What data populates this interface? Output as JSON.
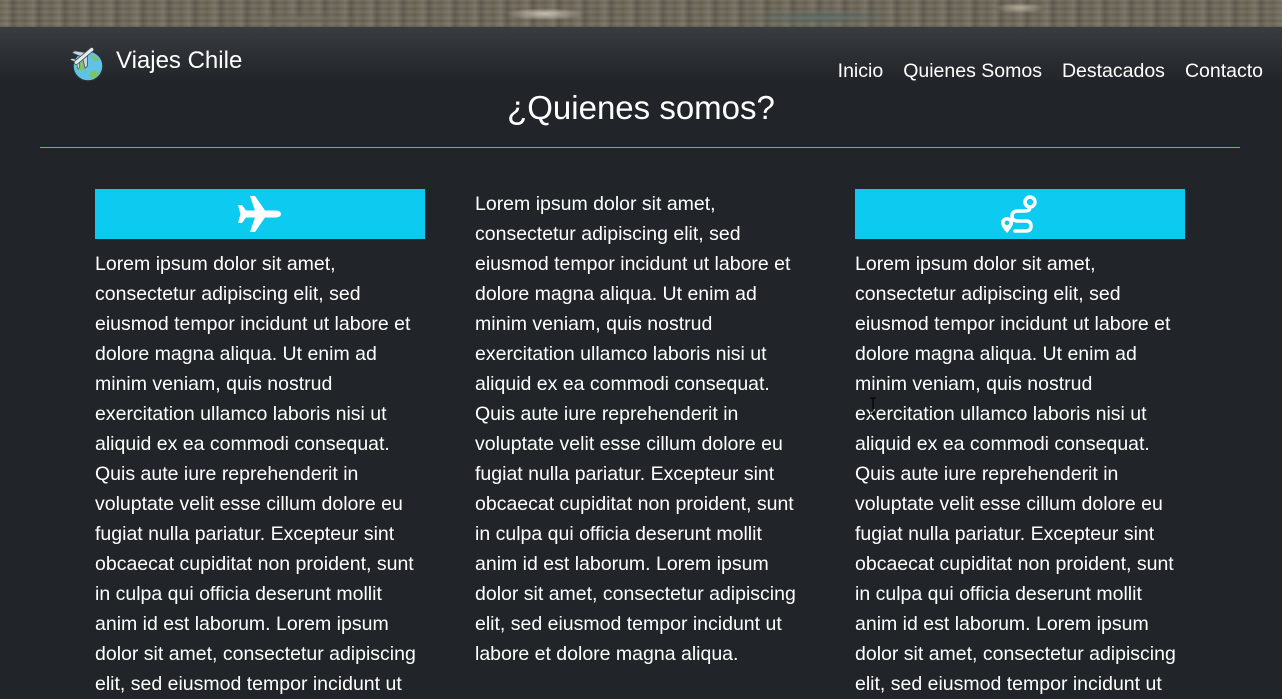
{
  "brand": {
    "name": "Viajes Chile"
  },
  "nav": {
    "items": [
      {
        "label": "Inicio"
      },
      {
        "label": "Quienes Somos"
      },
      {
        "label": "Destacados"
      },
      {
        "label": "Contacto"
      }
    ]
  },
  "section": {
    "title": "¿Quienes somos?"
  },
  "columns": [
    {
      "icon": "airplane-icon",
      "text": "Lorem ipsum dolor sit amet, consectetur adipiscing elit, sed eiusmod tempor incidunt ut labore et dolore magna aliqua. Ut enim ad minim veniam, quis nostrud exercitation ullamco laboris nisi ut aliquid ex ea commodi consequat. Quis aute iure reprehenderit in voluptate velit esse cillum dolore eu fugiat nulla pariatur. Excepteur sint obcaecat cupiditat non proident, sunt in culpa qui officia deserunt mollit anim id est laborum. Lorem ipsum dolor sit amet, consectetur adipiscing elit, sed eiusmod tempor incidunt ut"
    },
    {
      "icon": null,
      "text": "Lorem ipsum dolor sit amet, consectetur adipiscing elit, sed eiusmod tempor incidunt ut labore et dolore magna aliqua. Ut enim ad minim veniam, quis nostrud exercitation ullamco laboris nisi ut aliquid ex ea commodi consequat. Quis aute iure reprehenderit in voluptate velit esse cillum dolore eu fugiat nulla pariatur. Excepteur sint obcaecat cupiditat non proident, sunt in culpa qui officia deserunt mollit anim id est laborum. Lorem ipsum dolor sit amet, consectetur adipiscing elit, sed eiusmod tempor incidunt ut labore et dolore magna aliqua."
    },
    {
      "icon": "route-icon",
      "text": "Lorem ipsum dolor sit amet, consectetur adipiscing elit, sed eiusmod tempor incidunt ut labore et dolore magna aliqua. Ut enim ad minim veniam, quis nostrud exercitation ullamco laboris nisi ut aliquid ex ea commodi consequat. Quis aute iure reprehenderit in voluptate velit esse cillum dolore eu fugiat nulla pariatur. Excepteur sint obcaecat cupiditat non proident, sunt in culpa qui officia deserunt mollit anim id est laborum. Lorem ipsum dolor sit amet, consectetur adipiscing elit, sed eiusmod tempor incidunt ut"
    }
  ],
  "colors": {
    "background": "#212529",
    "accent": "#0dcaf0",
    "divider": "#3fb8d4",
    "text": "#ffffff"
  }
}
